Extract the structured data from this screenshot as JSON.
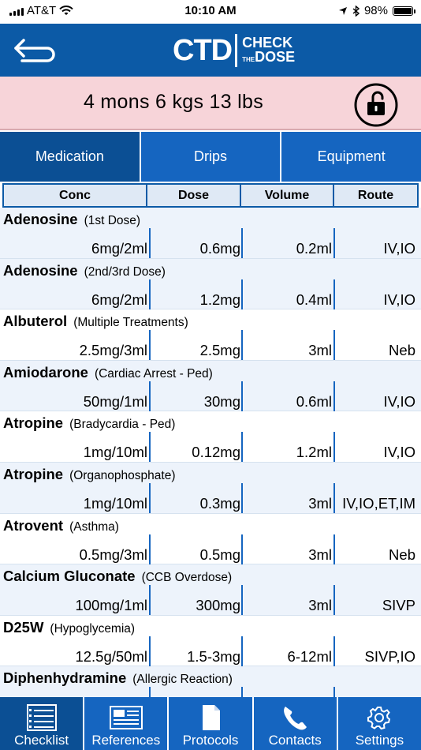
{
  "status_bar": {
    "carrier": "AT&T",
    "time": "10:10 AM",
    "battery": "98%"
  },
  "header": {
    "logo_main": "CTD",
    "logo_line1": "CHECK",
    "logo_the": "THE",
    "logo_line2": "DOSE"
  },
  "patient": {
    "summary": "4 mons 6 kgs 13 lbs"
  },
  "tabs": [
    {
      "label": "Medication",
      "active": true
    },
    {
      "label": "Drips",
      "active": false
    },
    {
      "label": "Equipment",
      "active": false
    }
  ],
  "columns": {
    "conc": "Conc",
    "dose": "Dose",
    "volume": "Volume",
    "route": "Route"
  },
  "medications": [
    {
      "name": "Adenosine",
      "indication": "(1st Dose)",
      "conc": "6mg/2ml",
      "dose": "0.6mg",
      "volume": "0.2ml",
      "route": "IV,IO"
    },
    {
      "name": "Adenosine",
      "indication": "(2nd/3rd Dose)",
      "conc": "6mg/2ml",
      "dose": "1.2mg",
      "volume": "0.4ml",
      "route": "IV,IO"
    },
    {
      "name": "Albuterol",
      "indication": "(Multiple Treatments)",
      "conc": "2.5mg/3ml",
      "dose": "2.5mg",
      "volume": "3ml",
      "route": "Neb"
    },
    {
      "name": "Amiodarone",
      "indication": "(Cardiac Arrest - Ped)",
      "conc": "50mg/1ml",
      "dose": "30mg",
      "volume": "0.6ml",
      "route": "IV,IO"
    },
    {
      "name": "Atropine",
      "indication": "(Bradycardia - Ped)",
      "conc": "1mg/10ml",
      "dose": "0.12mg",
      "volume": "1.2ml",
      "route": "IV,IO"
    },
    {
      "name": "Atropine",
      "indication": "(Organophosphate)",
      "conc": "1mg/10ml",
      "dose": "0.3mg",
      "volume": "3ml",
      "route": "IV,IO,ET,IM"
    },
    {
      "name": "Atrovent",
      "indication": "(Asthma)",
      "conc": "0.5mg/3ml",
      "dose": "0.5mg",
      "volume": "3ml",
      "route": "Neb"
    },
    {
      "name": "Calcium Gluconate",
      "indication": "(CCB Overdose)",
      "conc": "100mg/1ml",
      "dose": "300mg",
      "volume": "3ml",
      "route": "SIVP"
    },
    {
      "name": "D25W",
      "indication": "(Hypoglycemia)",
      "conc": "12.5g/50ml",
      "dose": "1.5-3mg",
      "volume": "6-12ml",
      "route": "SIVP,IO"
    },
    {
      "name": "Diphenhydramine",
      "indication": "(Allergic Reaction)",
      "conc": "",
      "dose": "",
      "volume": "",
      "route": ""
    }
  ],
  "bottom_nav": [
    {
      "label": "Checklist",
      "icon": "checklist-icon",
      "active": true
    },
    {
      "label": "References",
      "icon": "references-icon",
      "active": false
    },
    {
      "label": "Protocols",
      "icon": "document-icon",
      "active": false
    },
    {
      "label": "Contacts",
      "icon": "phone-icon",
      "active": false
    },
    {
      "label": "Settings",
      "icon": "gear-icon",
      "active": false
    }
  ],
  "colors": {
    "primary": "#1565c0",
    "primary_dark": "#0b4f94",
    "patient_bg": "#f7d4d9",
    "row_alt": "#edf3fb"
  }
}
